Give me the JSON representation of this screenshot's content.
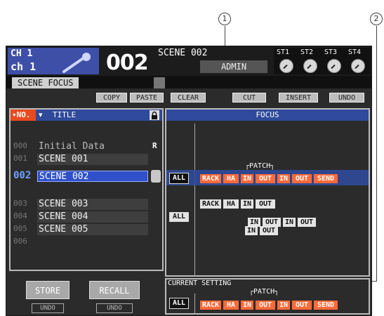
{
  "callouts": [
    "1",
    "2"
  ],
  "header": {
    "ch_top": "CH 1",
    "ch_name": "ch 1",
    "scene_number": "002",
    "scene_label": "SCENE 002",
    "user": "ADMIN",
    "st_labels": [
      "ST1",
      "ST2",
      "ST3",
      "ST4"
    ]
  },
  "tab": {
    "label": "SCENE FOCUS"
  },
  "toolbar": {
    "copy": "COPY",
    "paste": "PASTE",
    "clear": "CLEAR",
    "cut": "CUT",
    "insert": "INSERT",
    "undo": "UNDO"
  },
  "list": {
    "no_label": "NO.",
    "title_label": "TITLE",
    "rows": [
      {
        "num": "000",
        "name": "Initial Data",
        "flag": "R"
      },
      {
        "num": "001",
        "name": "SCENE 001",
        "flag": ""
      },
      {
        "num": "002",
        "name": "SCENE 002",
        "flag": ""
      },
      {
        "num": "003",
        "name": "SCENE 003",
        "flag": ""
      },
      {
        "num": "004",
        "name": "SCENE 004",
        "flag": ""
      },
      {
        "num": "005",
        "name": "SCENE 005",
        "flag": ""
      },
      {
        "num": "006",
        "name": "",
        "flag": ""
      }
    ]
  },
  "buttons": {
    "store": "STORE",
    "recall": "RECALL",
    "undo_store": "UNDO",
    "undo_recall": "UNDO"
  },
  "focus": {
    "title": "FOCUS",
    "patch_label": "┌PATCH┐",
    "all": "ALL",
    "row001": [
      "IN",
      "OUT",
      "IN",
      "OUT"
    ],
    "row002": [
      "RACK",
      "HA",
      "IN",
      "OUT",
      "IN",
      "OUT",
      "SEND"
    ],
    "row003": [
      "RACK",
      "HA",
      "IN",
      "OUT"
    ],
    "row005": [
      "IN",
      "OUT"
    ]
  },
  "current": {
    "title": "CURRENT SETTING",
    "patch_label": "┌PATCH┐",
    "all": "ALL",
    "items": [
      "RACK",
      "HA",
      "IN",
      "OUT",
      "IN",
      "OUT",
      "SEND"
    ]
  }
}
